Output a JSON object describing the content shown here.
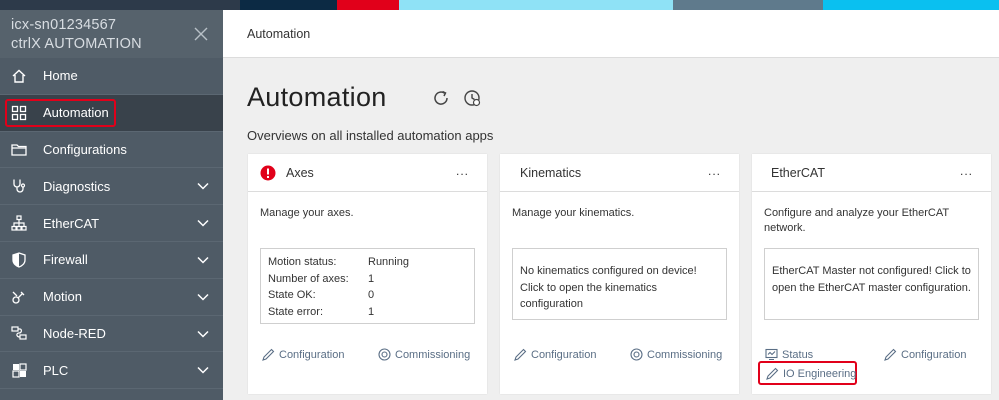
{
  "brand_strip": [
    "#2d3a4a",
    "#0c2a44",
    "#e1001a",
    "#8fe2f6",
    "#5f7a8c",
    "#0ac0f0"
  ],
  "sidebar": {
    "device_line1": "icx-sn01234567",
    "device_line2": "ctrlX AUTOMATION",
    "close_icon": "close-icon",
    "items": [
      {
        "label": "Home",
        "icon": "home-icon",
        "expandable": false
      },
      {
        "label": "Automation",
        "icon": "grid-icon",
        "expandable": false,
        "active": true
      },
      {
        "label": "Configurations",
        "icon": "folder-icon",
        "expandable": false
      },
      {
        "label": "Diagnostics",
        "icon": "stethoscope-icon",
        "expandable": true
      },
      {
        "label": "EtherCAT",
        "icon": "network-icon",
        "expandable": true
      },
      {
        "label": "Firewall",
        "icon": "shield-icon",
        "expandable": true
      },
      {
        "label": "Motion",
        "icon": "motion-icon",
        "expandable": true
      },
      {
        "label": "Node-RED",
        "icon": "node-red-icon",
        "expandable": true
      },
      {
        "label": "PLC",
        "icon": "plc-icon",
        "expandable": true
      }
    ]
  },
  "header": {
    "breadcrumb": "Automation"
  },
  "main": {
    "title": "Automation",
    "subtitle": "Overviews on all installed automation apps",
    "cards": {
      "axes": {
        "title": "Axes",
        "more": "...",
        "description": "Manage your axes.",
        "status": [
          {
            "key": "Motion status:",
            "value": "Running"
          },
          {
            "key": "Number of axes:",
            "value": "1"
          },
          {
            "key": "State OK:",
            "value": "0"
          },
          {
            "key": "State error:",
            "value": "1"
          }
        ],
        "link_configuration": "Configuration",
        "link_commissioning": "Commissioning"
      },
      "kinematics": {
        "title": "Kinematics",
        "more": "...",
        "description": "Manage your kinematics.",
        "message": "No kinematics configured on device! Click to open the kinematics configuration",
        "link_configuration": "Configuration",
        "link_commissioning": "Commissioning"
      },
      "ethercat": {
        "title": "EtherCAT",
        "more": "...",
        "description": "Configure and analyze your EtherCAT network.",
        "message": "EtherCAT Master not configured! Click to open the EtherCAT master configuration.",
        "link_status": "Status",
        "link_configuration": "Configuration",
        "link_io_engineering": "IO Engineering"
      }
    }
  },
  "colors": {
    "accent_red": "#e1001a",
    "sidebar_bg": "#4f5b66",
    "link": "#5a6e85"
  }
}
